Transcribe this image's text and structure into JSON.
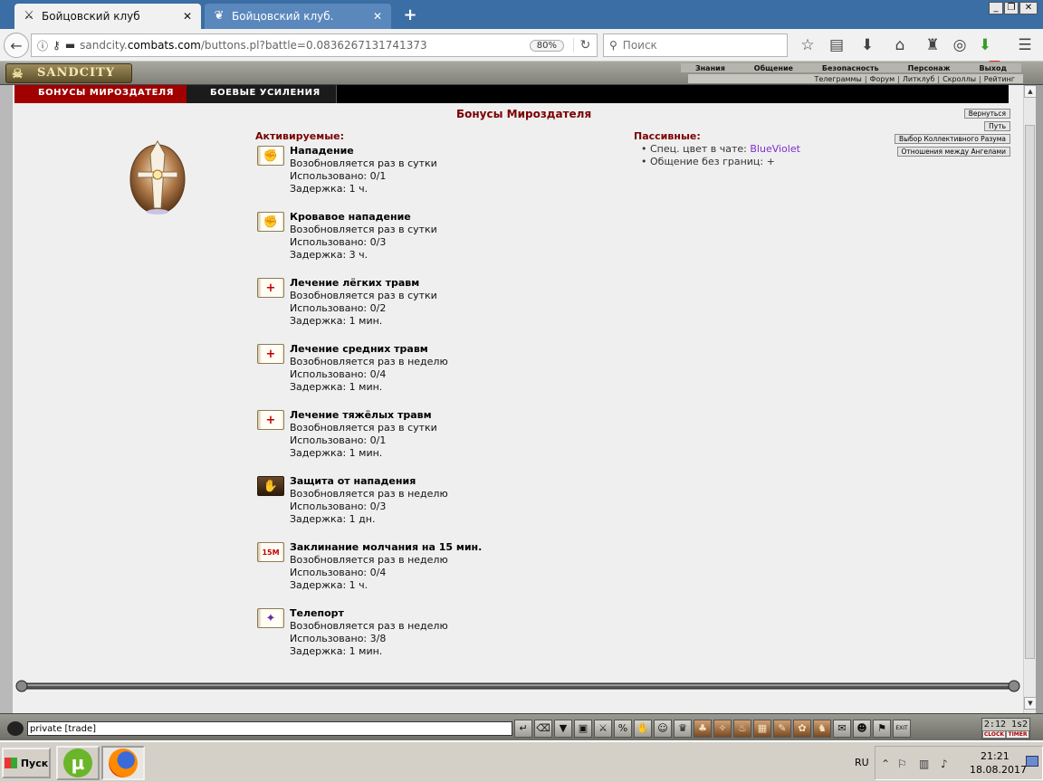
{
  "browser": {
    "tabs": [
      {
        "title": "Бойцовский клуб",
        "icon": "swords-icon",
        "active": true
      },
      {
        "title": "Бойцовский клуб.",
        "icon": "dragon-icon",
        "active": false
      }
    ],
    "new_tab": "+",
    "url": {
      "prefix": "sandcity.",
      "domain": "combats.com",
      "path": "/buttons.pl?battle=0.0836267131741373"
    },
    "zoom": "80%",
    "search_placeholder": "Поиск",
    "extension_badge": "?"
  },
  "game": {
    "logo": "SANDCITY",
    "top_menu": [
      "Знания",
      "Общение",
      "Безопасность",
      "Персонаж",
      "Выход"
    ],
    "sub_menu": [
      "Телеграммы",
      "Форум",
      "Литклуб",
      "Скроллы",
      "Рейтинг"
    ],
    "panel_tabs": [
      "БОНУСЫ МИРОЗДАТЕЛЯ",
      "БОЕВЫЕ УСИЛЕНИЯ"
    ],
    "page_title": "Бонусы Мироздателя",
    "side_buttons": [
      "Вернуться",
      "Путь",
      "Выбор Коллективного Разума",
      "Отношения между Ангелами"
    ],
    "active_title": "Активируемые:",
    "passive_title": "Пассивные:",
    "bonuses": [
      {
        "name": "Нападение",
        "renew": "Возобновляется раз в сутки",
        "used": "Использовано: 0/1",
        "delay": "Задержка: 1 ч.",
        "icon": "attack-scroll-icon",
        "glyph": "✊"
      },
      {
        "name": "Кровавое нападение",
        "renew": "Возобновляется раз в сутки",
        "used": "Использовано: 0/3",
        "delay": "Задержка: 3 ч.",
        "icon": "bloody-attack-scroll-icon",
        "glyph": "✊"
      },
      {
        "name": "Лечение лёгких травм",
        "renew": "Возобновляется раз в сутки",
        "used": "Использовано: 0/2",
        "delay": "Задержка: 1 мин.",
        "icon": "heal-light-scroll-icon",
        "glyph": "+"
      },
      {
        "name": "Лечение средних травм",
        "renew": "Возобновляется раз в неделю",
        "used": "Использовано: 0/4",
        "delay": "Задержка: 1 мин.",
        "icon": "heal-medium-scroll-icon",
        "glyph": "+"
      },
      {
        "name": "Лечение тяжёлых травм",
        "renew": "Возобновляется раз в сутки",
        "used": "Использовано: 0/1",
        "delay": "Задержка: 1 мин.",
        "icon": "heal-heavy-scroll-icon",
        "glyph": "+"
      },
      {
        "name": "Защита от нападения",
        "renew": "Возобновляется раз в неделю",
        "used": "Использовано: 0/3",
        "delay": "Задержка: 1 дн.",
        "icon": "attack-protection-icon",
        "glyph": "✋"
      },
      {
        "name": "Заклинание молчания на 15 мин.",
        "renew": "Возобновляется раз в неделю",
        "used": "Использовано: 0/4",
        "delay": "Задержка: 1 ч.",
        "icon": "silence-scroll-icon",
        "glyph": "15M"
      },
      {
        "name": "Телепорт",
        "renew": "Возобновляется раз в неделю",
        "used": "Использовано: 3/8",
        "delay": "Задержка: 1 мин.",
        "icon": "teleport-scroll-icon",
        "glyph": "✦"
      }
    ],
    "passives": [
      {
        "label": "Спец. цвет в чате: ",
        "value": "BlueViolet"
      },
      {
        "label": "Общение без границ: ",
        "value": "+"
      }
    ],
    "chat_value": "private [trade]",
    "clock": {
      "time": "2:12 1s2",
      "exit_label": "EXIT",
      "labels": [
        "CLOCK",
        "TIMER"
      ]
    }
  },
  "taskbar": {
    "start": "Пуск",
    "lang": "RU",
    "time": "21:21",
    "date": "18.08.2017"
  },
  "colors": {
    "accent_red": "#a00000",
    "heading": "#7a0000",
    "violet": "#7b2fd0"
  }
}
